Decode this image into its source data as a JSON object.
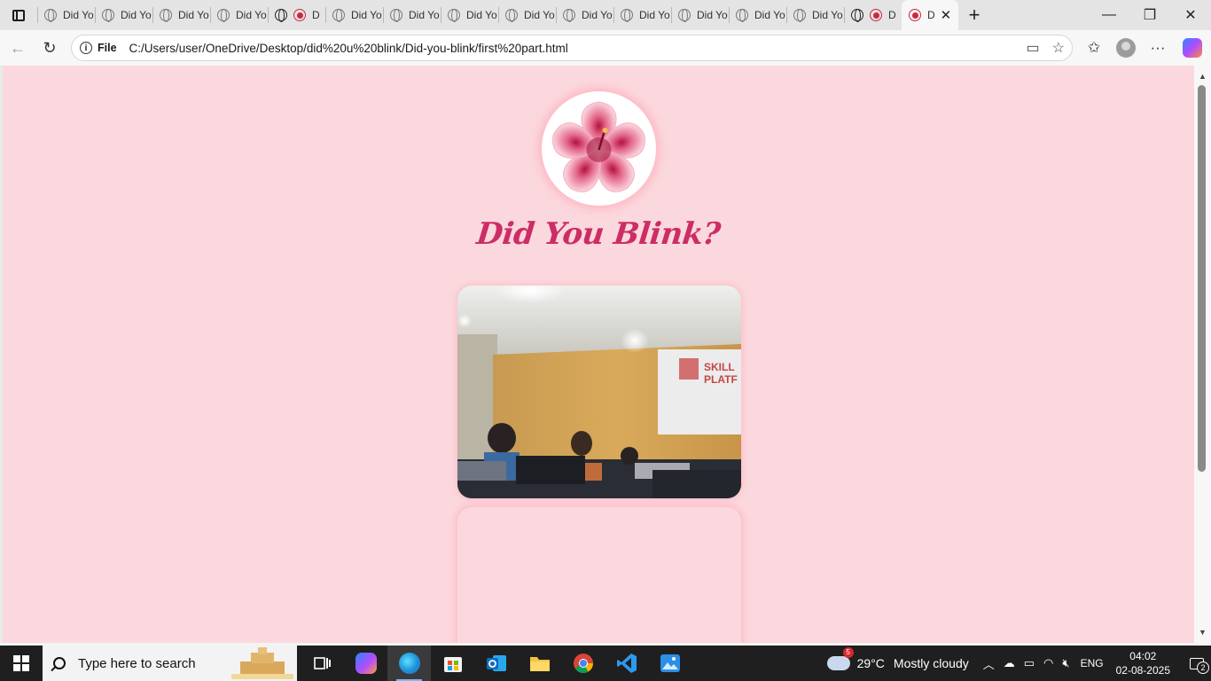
{
  "browser": {
    "tabs": [
      {
        "label": "Did Yo",
        "icon": "globe-icon"
      },
      {
        "label": "Did Yo",
        "icon": "globe-icon"
      },
      {
        "label": "Did Yo",
        "icon": "globe-icon"
      },
      {
        "label": "Did Yo",
        "icon": "globe-icon"
      },
      {
        "label": "D",
        "icon": "globe-icon",
        "dark": true,
        "rec": true
      },
      {
        "label": "Did Yo",
        "icon": "globe-icon"
      },
      {
        "label": "Did Yo",
        "icon": "globe-icon"
      },
      {
        "label": "Did Yo",
        "icon": "globe-icon"
      },
      {
        "label": "Did Yo",
        "icon": "globe-icon"
      },
      {
        "label": "Did Yo",
        "icon": "globe-icon"
      },
      {
        "label": "Did Yo",
        "icon": "globe-icon"
      },
      {
        "label": "Did Yo",
        "icon": "globe-icon"
      },
      {
        "label": "Did Yo",
        "icon": "globe-icon"
      },
      {
        "label": "Did Yo",
        "icon": "globe-icon"
      },
      {
        "label": "D",
        "icon": "globe-icon",
        "dark": true,
        "rec": true
      }
    ],
    "active_tab": {
      "label": "D",
      "icon": "recording-icon",
      "close": "✕"
    },
    "new_tab": "+",
    "window_controls": {
      "minimize": "—",
      "maximize": "❐",
      "close": "✕"
    },
    "address": {
      "scheme_label": "File",
      "url": "C:/Users/user/OneDrive/Desktop/did%20u%20blink/Did-you-blink/first%20part.html"
    }
  },
  "page": {
    "title": "Did You Blink?",
    "background_color": "#fbd8dd",
    "accent_color": "#cc2d66"
  },
  "taskbar": {
    "search_placeholder": "Type here to search",
    "weather": {
      "temp": "29°C",
      "condition": "Mostly cloudy",
      "badge": "5"
    },
    "language": "ENG",
    "time": "04:02",
    "date": "02-08-2025",
    "notifications": "2"
  }
}
